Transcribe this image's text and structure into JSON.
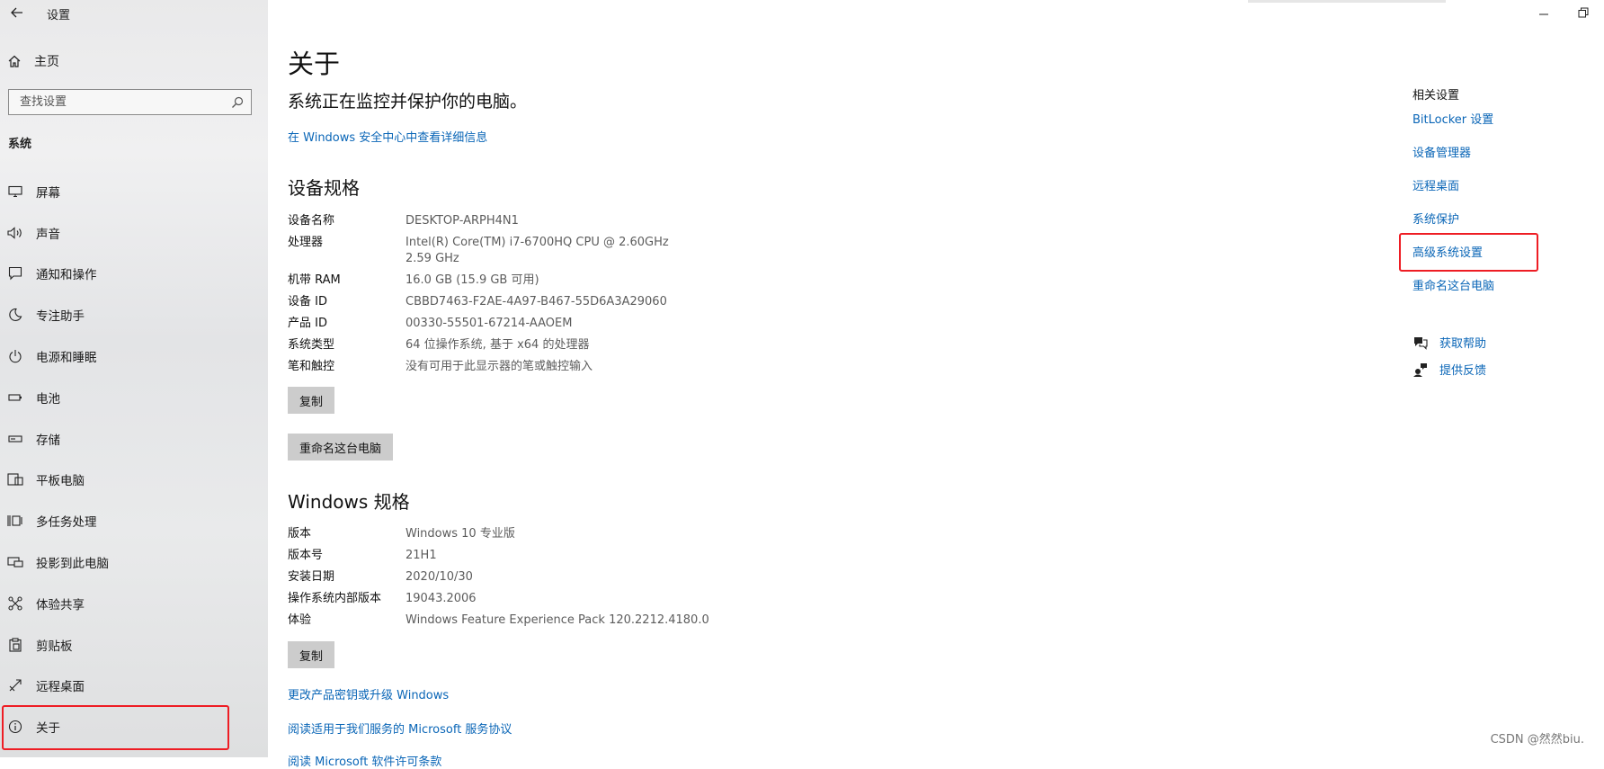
{
  "window": {
    "title": "设置"
  },
  "sidebar": {
    "home_label": "主页",
    "search_placeholder": "查找设置",
    "section_label": "系统",
    "items": [
      {
        "label": "屏幕",
        "icon": "display-icon"
      },
      {
        "label": "声音",
        "icon": "speaker-icon"
      },
      {
        "label": "通知和操作",
        "icon": "notification-icon"
      },
      {
        "label": "专注助手",
        "icon": "moon-icon"
      },
      {
        "label": "电源和睡眠",
        "icon": "power-icon"
      },
      {
        "label": "电池",
        "icon": "battery-icon"
      },
      {
        "label": "存储",
        "icon": "storage-icon"
      },
      {
        "label": "平板电脑",
        "icon": "tablet-icon"
      },
      {
        "label": "多任务处理",
        "icon": "multitask-icon"
      },
      {
        "label": "投影到此电脑",
        "icon": "project-icon"
      },
      {
        "label": "体验共享",
        "icon": "share-icon"
      },
      {
        "label": "剪贴板",
        "icon": "clipboard-icon"
      },
      {
        "label": "远程桌面",
        "icon": "remote-icon"
      },
      {
        "label": "关于",
        "icon": "info-icon"
      }
    ],
    "active_item": "关于"
  },
  "main": {
    "title": "关于",
    "protect_message": "系统正在监控并保护你的电脑。",
    "security_link": "在 Windows 安全中心中查看详细信息",
    "device_specs": {
      "heading": "设备规格",
      "rows": [
        {
          "label": "设备名称",
          "value": "DESKTOP-ARPH4N1"
        },
        {
          "label": "处理器",
          "value": "Intel(R) Core(TM) i7-6700HQ CPU @ 2.60GHz\n2.59 GHz"
        },
        {
          "label": "机带 RAM",
          "value": "16.0 GB (15.9 GB 可用)"
        },
        {
          "label": "设备 ID",
          "value": "CBBD7463-F2AE-4A97-B467-55D6A3A29060"
        },
        {
          "label": "产品 ID",
          "value": "00330-55501-67214-AAOEM"
        },
        {
          "label": "系统类型",
          "value": "64 位操作系统, 基于 x64 的处理器"
        },
        {
          "label": "笔和触控",
          "value": "没有可用于此显示器的笔或触控输入"
        }
      ],
      "copy_button": "复制",
      "rename_button": "重命名这台电脑"
    },
    "windows_specs": {
      "heading": "Windows 规格",
      "rows": [
        {
          "label": "版本",
          "value": "Windows 10 专业版"
        },
        {
          "label": "版本号",
          "value": "21H1"
        },
        {
          "label": "安装日期",
          "value": "2020/10/30"
        },
        {
          "label": "操作系统内部版本",
          "value": "19043.2006"
        },
        {
          "label": "体验",
          "value": "Windows Feature Experience Pack 120.2212.4180.0"
        }
      ],
      "copy_button": "复制"
    },
    "links": [
      "更改产品密钥或升级 Windows",
      "阅读适用于我们服务的 Microsoft 服务协议",
      "阅读 Microsoft 软件许可条款"
    ]
  },
  "related": {
    "heading": "相关设置",
    "links": [
      "BitLocker 设置",
      "设备管理器",
      "远程桌面",
      "系统保护",
      "高级系统设置",
      "重命名这台电脑"
    ],
    "highlighted": "高级系统设置",
    "help": [
      {
        "label": "获取帮助",
        "icon": "help-chat-icon"
      },
      {
        "label": "提供反馈",
        "icon": "feedback-icon"
      }
    ]
  },
  "watermark": "CSDN @然然biu.",
  "colors": {
    "link": "#0a66b7",
    "highlight_box": "#ee1d24",
    "button_bg": "#cccccc"
  }
}
